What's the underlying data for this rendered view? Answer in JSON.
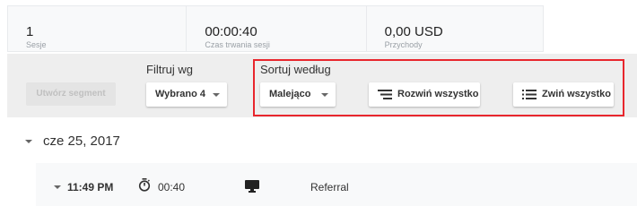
{
  "metrics": [
    {
      "value": "1",
      "label": "Sesje"
    },
    {
      "value": "00:00:40",
      "label": "Czas trwania sesji"
    },
    {
      "value": "0,00 USD",
      "label": "Przychody"
    }
  ],
  "toolbar": {
    "create_segment_label": "Utwórz segment",
    "filter_title": "Filtruj wg",
    "filter_value": "Wybrano 4",
    "sort_title": "Sortuj według",
    "sort_value": "Malejąco",
    "expand_all_label": "Rozwiń wszystko",
    "collapse_all_label": "Zwiń wszystko",
    "highlight_color": "#e8262d"
  },
  "date_group": {
    "date": "cze 25, 2017"
  },
  "session": {
    "time": "11:49 PM",
    "duration": "00:40",
    "source": "Referral",
    "icons": {
      "timer": "stopwatch-icon",
      "device": "desktop-icon"
    }
  }
}
